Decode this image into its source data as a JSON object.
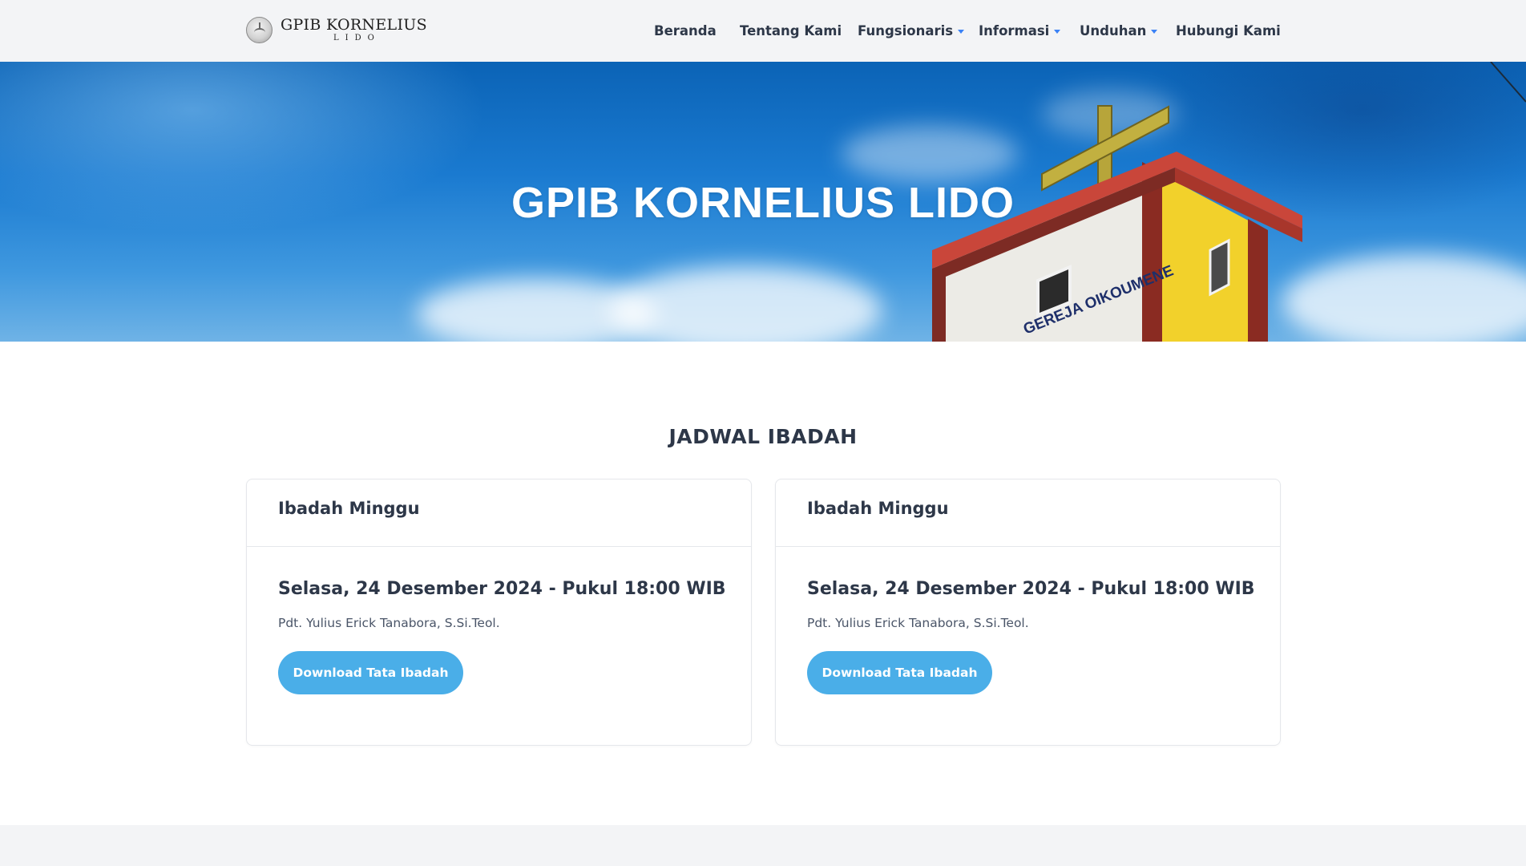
{
  "brand": {
    "name": "GPIB KORNELIUS",
    "subname": "LIDO"
  },
  "nav": {
    "items": [
      {
        "label": "Beranda"
      },
      {
        "label": "Tentang Kami"
      },
      {
        "label": "Fungsionaris"
      },
      {
        "label": "Informasi"
      },
      {
        "label": "Unduhan"
      },
      {
        "label": "Hubungi Kami"
      }
    ]
  },
  "hero": {
    "title": "GPIB KORNELIUS LIDO",
    "sign_text": "GEREJA OIKOUMENE"
  },
  "schedule": {
    "title": "JADWAL IBADAH",
    "cards": [
      {
        "heading": "Ibadah Minggu",
        "date": "Selasa, 24 Desember 2024 - Pukul 18:00 WIB",
        "pastor": "Pdt. Yulius Erick Tanabora, S.Si.Teol.",
        "button": "Download Tata Ibadah"
      },
      {
        "heading": "Ibadah Minggu",
        "date": "Selasa, 24 Desember 2024 - Pukul 18:00 WIB",
        "pastor": "Pdt. Yulius Erick Tanabora, S.Si.Teol.",
        "button": "Download Tata Ibadah"
      }
    ]
  },
  "colors": {
    "accent": "#4aaee8",
    "caret": "#3b82f6",
    "text": "#2d3748",
    "navbar_bg": "#f3f4f6"
  }
}
